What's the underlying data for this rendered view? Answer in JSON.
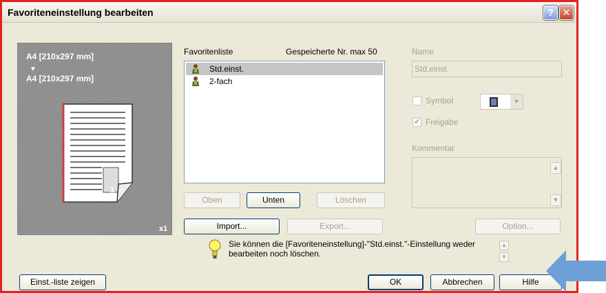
{
  "window": {
    "title": "Favoriteneinstellung bearbeiten",
    "help_glyph": "?",
    "close_glyph": "✕"
  },
  "preview": {
    "source_size": "A4 [210x297 mm]",
    "arrow": "▼",
    "target_size": "A4 [210x297 mm]",
    "page_number": "1",
    "copies": "x1"
  },
  "favorites": {
    "list_label": "Favoritenliste",
    "saved_label": "Gespeicherte Nr. max 50",
    "items": [
      {
        "label": "Std.einst.",
        "selected": true
      },
      {
        "label": "2-fach",
        "selected": false
      }
    ]
  },
  "list_buttons": {
    "up": "Oben",
    "down": "Unten",
    "delete": "Löschen"
  },
  "io_buttons": {
    "import": "Import...",
    "export": "Export...",
    "option": "Option..."
  },
  "details": {
    "name_label": "Name",
    "name_value": "Std.einst.",
    "symbol_label": "Symbol",
    "symbol_checked": false,
    "share_label": "Freigabe",
    "share_checked": true,
    "comment_label": "Kommentar",
    "comment_value": ""
  },
  "info": {
    "line1": "Sie können die [Favoriteneinstellung]-\"Std.einst.\"-Einstellung weder",
    "line2": "bearbeiten noch löschen."
  },
  "footer": {
    "show_list": "Einst.-liste zeigen",
    "ok": "OK",
    "cancel": "Abbrechen",
    "help": "Hilfe"
  },
  "colors": {
    "highlight_border": "#e32222",
    "annotation_arrow": "#6e9fd6",
    "dialog_bg": "#ece9d8"
  }
}
